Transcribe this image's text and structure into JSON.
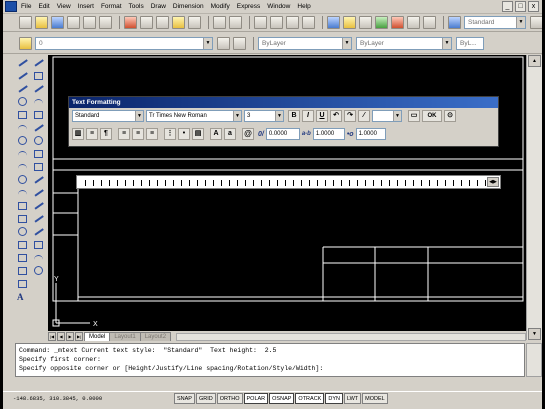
{
  "menu": [
    "File",
    "Edit",
    "View",
    "Insert",
    "Format",
    "Tools",
    "Draw",
    "Dimension",
    "Modify",
    "Express",
    "Window",
    "Help"
  ],
  "window_buttons": [
    "_",
    "□",
    "x"
  ],
  "toolbar1": {
    "text_style": "Standard"
  },
  "toolbar2": {
    "layer_value": "0",
    "layer_prop": "ByLayer",
    "linetype": "ByLayer",
    "lineweight": "ByL..."
  },
  "palette_letter": "A",
  "text_formatting": {
    "title": "Text Formatting",
    "style": "Standard",
    "font": "Tr Times New Roman",
    "height": "3",
    "bold": "B",
    "italic": "I",
    "underline": "U",
    "ok": "OK",
    "at_symbol": "@",
    "oblique_label": "0/",
    "oblique_value": "0.0000",
    "tracking_label": "a-b",
    "tracking_value": "1.0000",
    "width_label": "•o",
    "width_value": "1.0000"
  },
  "tabs": [
    "Model",
    "Layout1",
    "Layout2"
  ],
  "ucs": {
    "x": "X",
    "y": "Y"
  },
  "command_lines": [
    "Command: _mtext Current text style:  \"Standard\"  Text height:  2.5",
    "Specify first corner:",
    "Specify opposite corner or [Height/Justify/Line spacing/Rotation/Style/Width]:"
  ],
  "status": {
    "coords": "-148.6835, 310.3845, 0.0000",
    "buttons": [
      "SNAP",
      "GRID",
      "ORTHO",
      "POLAR",
      "OSNAP",
      "OTRACK",
      "DYN",
      "LWT",
      "MODEL"
    ]
  }
}
